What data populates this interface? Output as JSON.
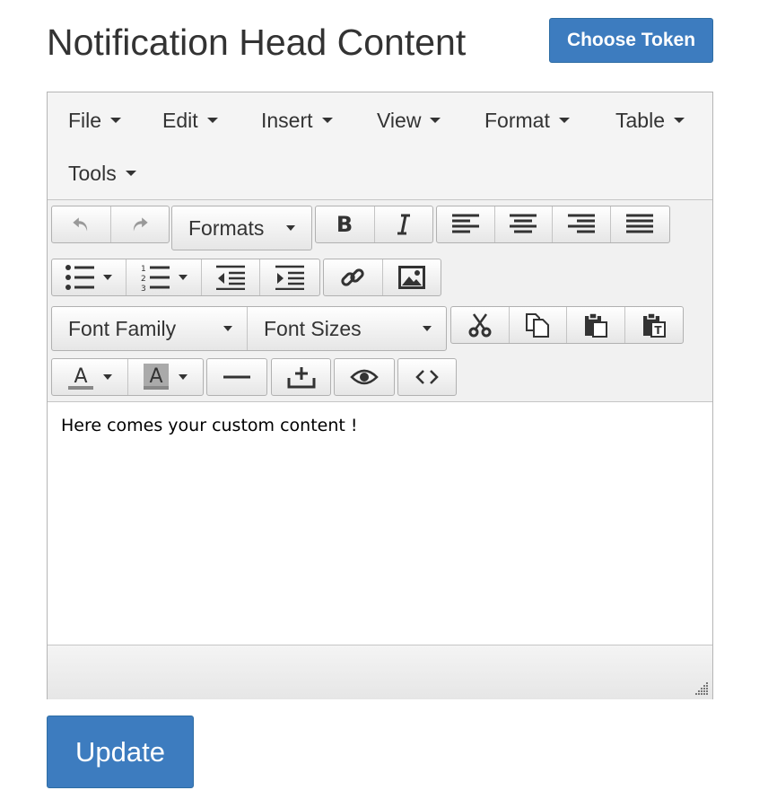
{
  "page": {
    "title": "Notification Head Content"
  },
  "choose_token_label": "Choose Token",
  "update_label": "Update",
  "menubar": {
    "items": [
      {
        "label": "File"
      },
      {
        "label": "Edit"
      },
      {
        "label": "Insert"
      },
      {
        "label": "View"
      },
      {
        "label": "Format"
      },
      {
        "label": "Table"
      },
      {
        "label": "Tools"
      }
    ]
  },
  "toolbar": {
    "formats_label": "Formats",
    "font_family_label": "Font Family",
    "font_sizes_label": "Font Sizes",
    "icons": [
      "undo-icon",
      "redo-icon",
      "bold-icon",
      "italic-icon",
      "align-left-icon",
      "align-center-icon",
      "align-right-icon",
      "justify-icon",
      "bullet-list-icon",
      "numbered-list-icon",
      "outdent-icon",
      "indent-icon",
      "link-icon",
      "image-icon",
      "cut-icon",
      "copy-icon",
      "paste-icon",
      "paste-text-icon",
      "text-color-icon",
      "background-color-icon",
      "horizontal-rule-icon",
      "insert-template-icon",
      "preview-icon",
      "source-code-icon"
    ]
  },
  "editor": {
    "content": "Here comes your custom content !"
  },
  "colors": {
    "primary": "#3d7cbf",
    "toolbar_bg": "#f1f1f1",
    "text": "#333333"
  }
}
